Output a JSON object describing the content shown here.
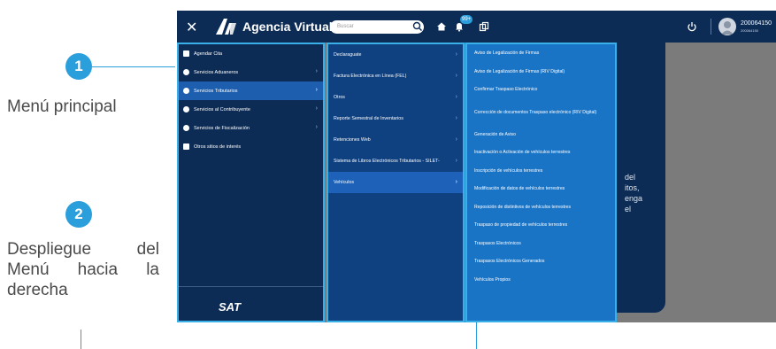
{
  "annotations": {
    "badge1": "1",
    "label1": "Menú principal",
    "badge2": "2",
    "label2_lines": [
      "Despliegue del",
      "Menú hacia la",
      "derecha"
    ]
  },
  "topbar": {
    "app_title": "Agencia Virtual",
    "search_placeholder": "Buscar",
    "notification_count": "99+",
    "user_id": "200064150",
    "user_sub": "200064150"
  },
  "menu_principal": [
    {
      "label": "Agendar Cita",
      "icon": "calendar-icon",
      "chevron": false
    },
    {
      "label": "Servicios Aduaneros",
      "icon": "circle-plus-icon",
      "chevron": true
    },
    {
      "label": "Servicios Tributarios",
      "icon": "circle-plus-icon",
      "chevron": true,
      "active": true
    },
    {
      "label": "Servicios al Contribuyente",
      "icon": "circle-plus-icon",
      "chevron": true
    },
    {
      "label": "Servicios de Fiscalización",
      "icon": "circle-plus-icon",
      "chevron": true
    },
    {
      "label": "Otros sitios de interés",
      "icon": "external-link-icon",
      "chevron": false
    }
  ],
  "footer_logo": "SAT",
  "submenu": [
    {
      "label": "Declaraguate",
      "chevron": true
    },
    {
      "label": "Factura Electrónica en Línea (FEL)",
      "chevron": true
    },
    {
      "label": "Otros",
      "chevron": true
    },
    {
      "label": "Reporte Semestral de Inventarios",
      "chevron": true
    },
    {
      "label": "Retenciones Web",
      "chevron": true
    },
    {
      "label": "Sistema de Libros Electrónicos Tributarios - SILET-",
      "chevron": true
    },
    {
      "label": "Vehículos",
      "chevron": true,
      "active": true
    }
  ],
  "vehiculos_menu": [
    "Aviso de Legalización de Firmas",
    "Aviso de Legalización de Firmas (RIV Digital)",
    "Confirmar Traspaso Electrónico",
    "Corrección de documentos Traspaso electrónico (RIV Digital)",
    "Generación de Aviso",
    "Inactivación o Activación de vehículos terrestres",
    "Inscripción de vehículos terrestres",
    "Modificación de datos de vehículos terrestres",
    "Reposición de distintivos de vehículos terrestres",
    "Traspaso de propiedad de vehículos terrestres",
    "Traspasos Electrónicos",
    "Traspasos Electrónicos Generados",
    "Vehículos Propios"
  ],
  "card_text_lines": [
    "del",
    "itos,",
    "enga",
    "el"
  ],
  "colors": {
    "topbar": "#0d2c55",
    "menu_principal_bg": "#0d2c55",
    "submenu_bg": "#0f4080",
    "vehiculos_bg": "#1a74c6",
    "highlight_border": "#3ab0e8",
    "annotation_accent": "#2a9fdc"
  }
}
